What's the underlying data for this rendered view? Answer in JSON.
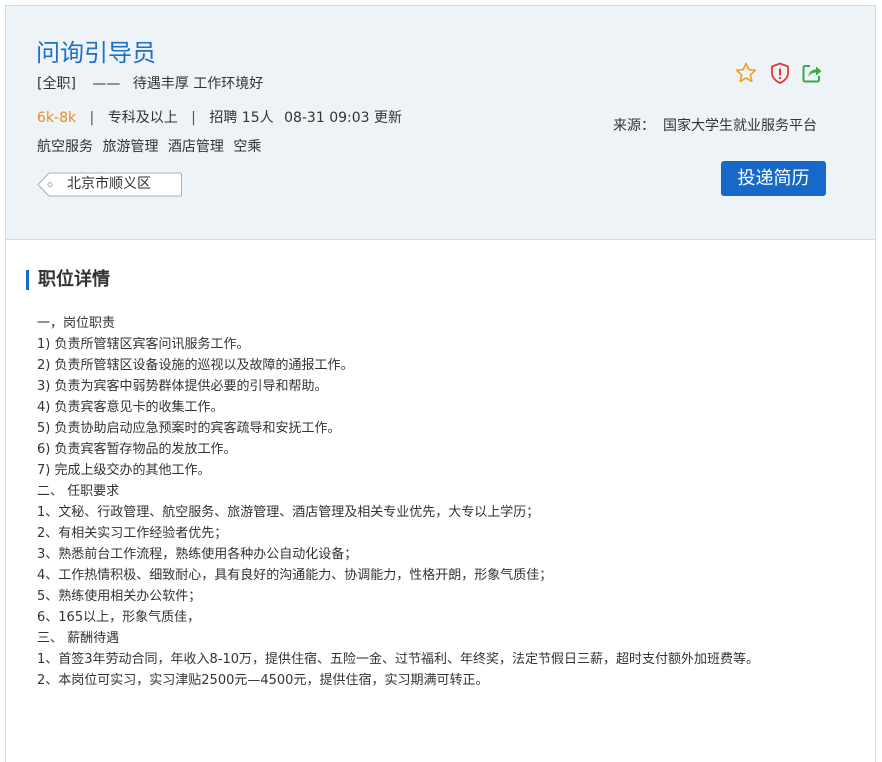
{
  "job": {
    "title": "问询引导员",
    "type": "[全职]",
    "dash": "——",
    "benefits": "待遇丰厚 工作环境好",
    "salary": "6k-8k",
    "sep": "|",
    "education": "专科及以上",
    "recruit": "招聘 15人",
    "updated": "08-31 09:03 更新",
    "tags": [
      "航空服务",
      "旅游管理",
      "酒店管理",
      "空乘"
    ],
    "location": "北京市顺义区"
  },
  "source": {
    "label": "来源：",
    "value": "国家大学生就业服务平台"
  },
  "actions": {
    "apply_label": "投递简历",
    "icons": [
      "star-outline-icon",
      "shield-alert-icon",
      "share-icon"
    ]
  },
  "colors": {
    "accent": "#1669c9",
    "title": "#1f6fc9",
    "salary": "#f08a24",
    "header_bg": "#eef3f8",
    "star": "#f0a020",
    "shield": "#e53935",
    "share": "#3aa845"
  },
  "details": {
    "section_title": "职位详情",
    "lines": [
      "一，岗位职责",
      "1) 负责所管辖区宾客问讯服务工作。",
      "2) 负责所管辖区设备设施的巡视以及故障的通报工作。",
      "3) 负责为宾客中弱势群体提供必要的引导和帮助。",
      "4) 负责宾客意见卡的收集工作。",
      "5) 负责协助启动应急预案时的宾客疏导和安抚工作。",
      "6) 负责宾客暂存物品的发放工作。",
      "7) 完成上级交办的其他工作。",
      "二、 任职要求",
      "1、文秘、行政管理、航空服务、旅游管理、酒店管理及相关专业优先，大专以上学历；",
      "2、有相关实习工作经验者优先；",
      "3、熟悉前台工作流程，熟练使用各种办公自动化设备；",
      "4、工作热情积极、细致耐心，具有良好的沟通能力、协调能力，性格开朗，形象气质佳；",
      "5、熟练使用相关办公软件；",
      "6、165以上，形象气质佳，",
      "三、 薪酬待遇",
      "1、首签3年劳动合同，年收入8-10万，提供住宿、五险一金、过节福利、年终奖，法定节假日三薪，超时支付额外加班费等。",
      "2、本岗位可实习，实习津贴2500元—4500元，提供住宿，实习期满可转正。"
    ]
  }
}
